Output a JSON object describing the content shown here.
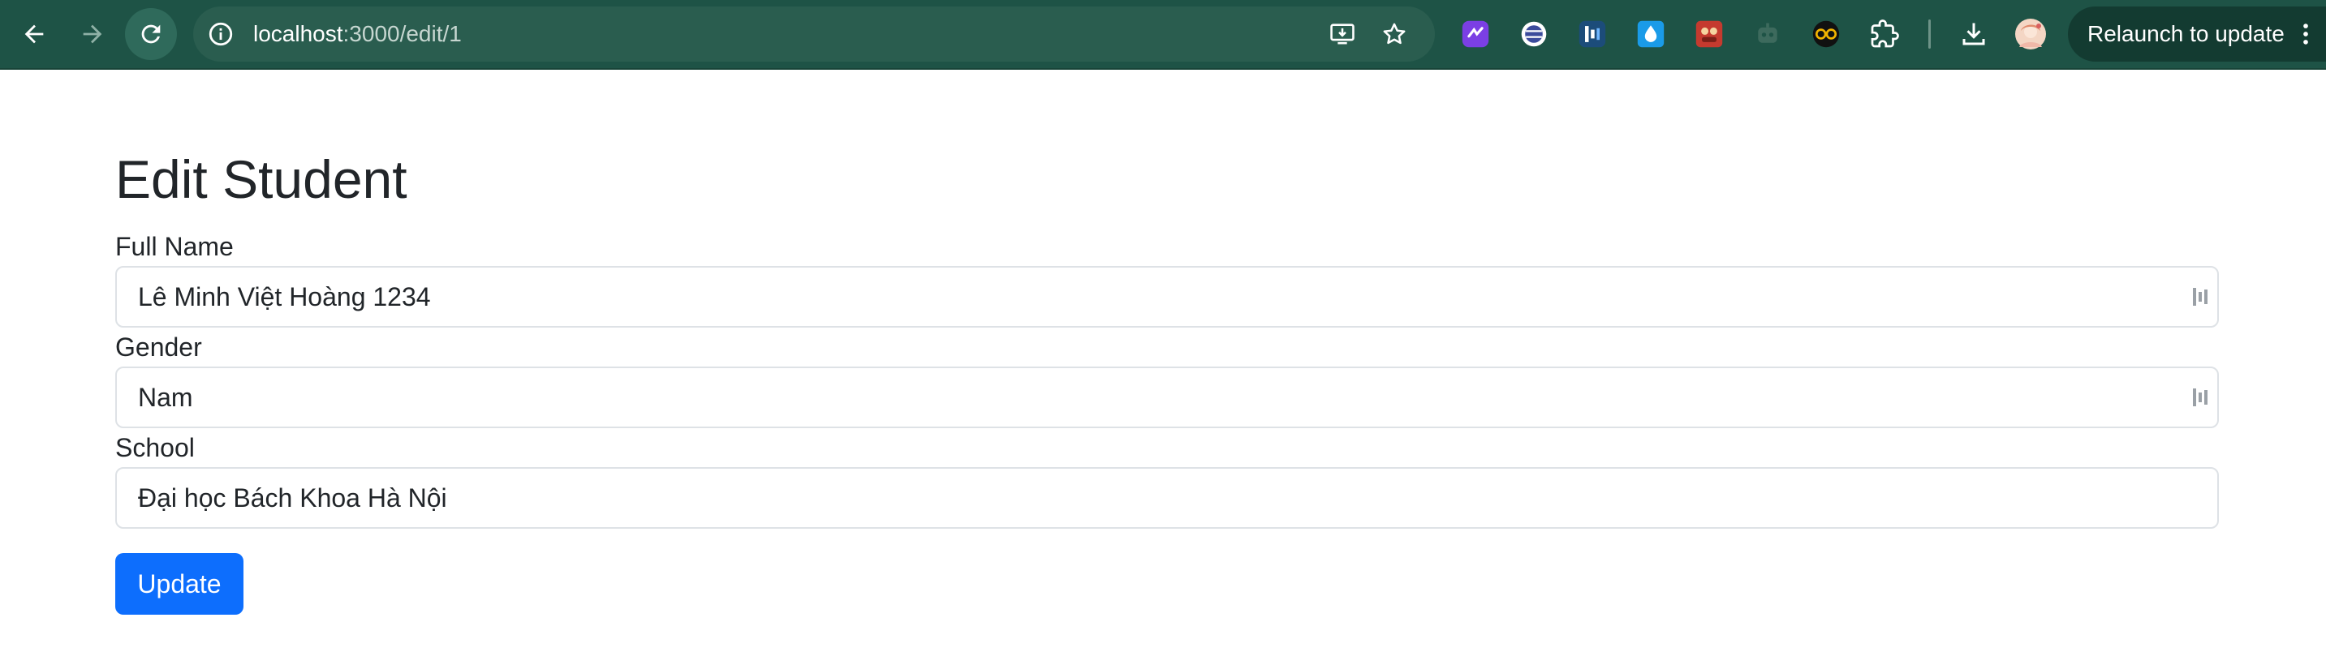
{
  "browser": {
    "url_host": "localhost",
    "url_path": ":3000/edit/1",
    "relaunch_label": "Relaunch to update",
    "icons": [
      "back-arrow-icon",
      "forward-arrow-icon",
      "reload-icon",
      "site-info-icon",
      "install-app-icon",
      "bookmark-star-icon",
      "extensions-puzzle-icon",
      "downloads-icon",
      "profile-avatar",
      "more-vert-icon"
    ],
    "colors": {
      "toolbar": "#1e5346",
      "omnibox": "#2a5d4f",
      "relaunch_pill": "#133b31"
    }
  },
  "form": {
    "title": "Edit Student",
    "fields": [
      {
        "label": "Full Name",
        "value": "Lê Minh Việt Hoàng 1234"
      },
      {
        "label": "Gender",
        "value": "Nam"
      },
      {
        "label": "School",
        "value": "Đại học Bách Khoa Hà Nội"
      }
    ],
    "submit_label": "Update",
    "colors": {
      "primary": "#0d6efd",
      "text": "#212529",
      "input_border": "#dee2e6"
    }
  }
}
